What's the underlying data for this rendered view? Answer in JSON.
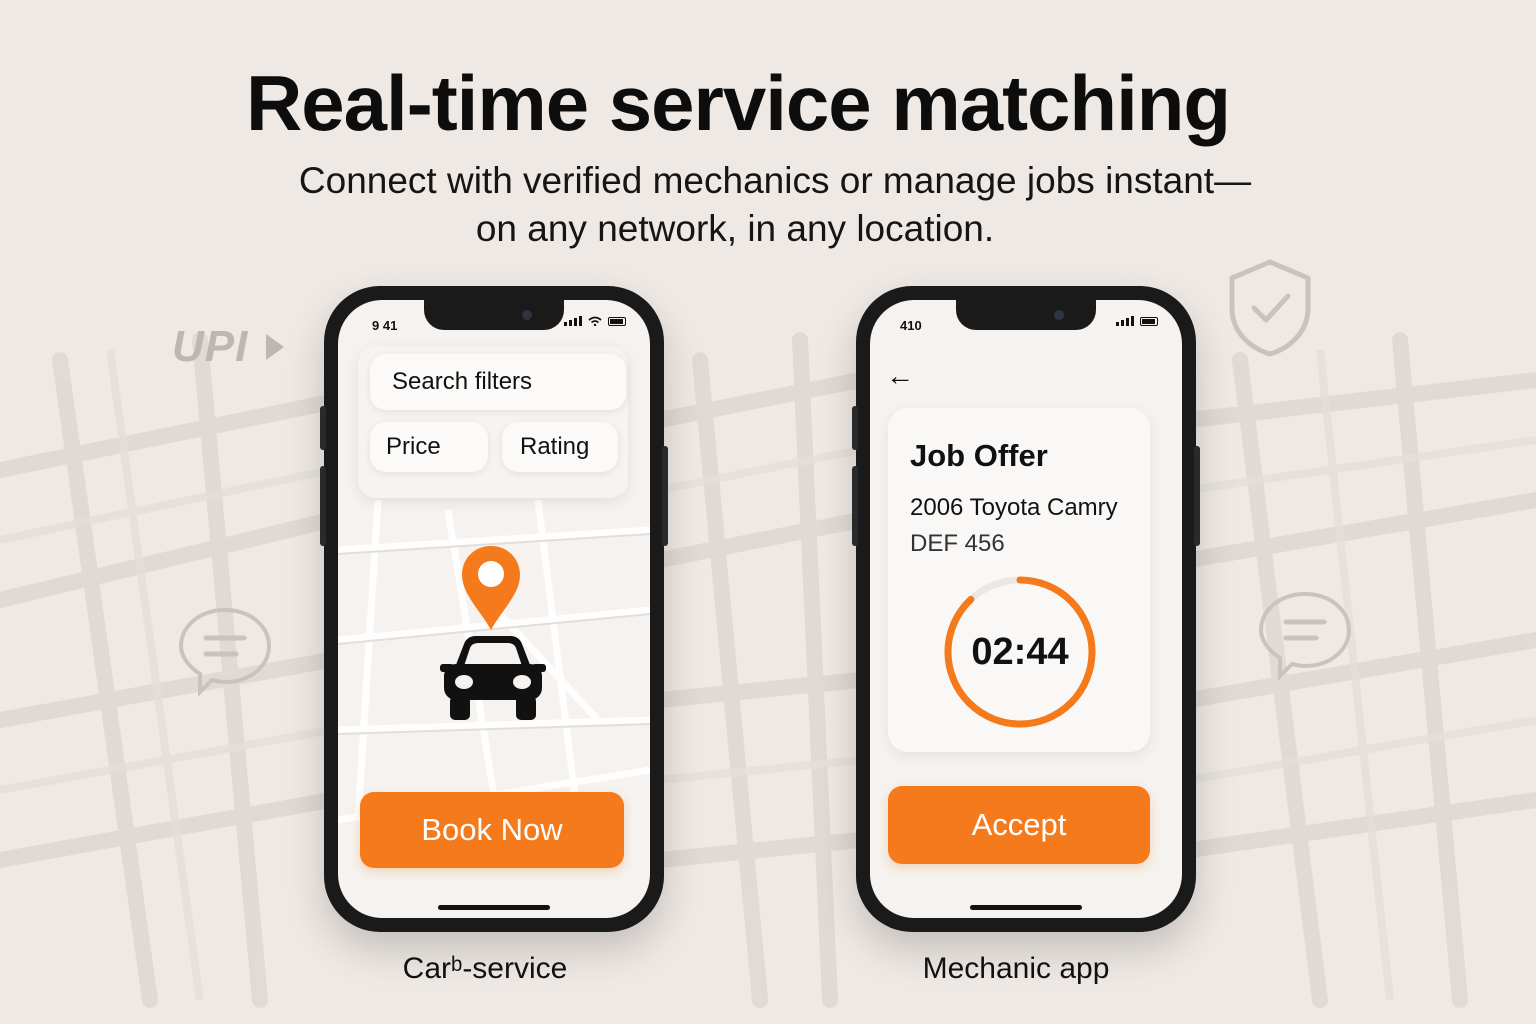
{
  "headline": "Real-time service matching",
  "subheadline_line1": "Connect with verified mechanics or manage jobs instant—",
  "subheadline_line2": "on any network, in any location.",
  "decor": {
    "upi_logo_text": "UPI",
    "shield_icon": "shield-check-icon",
    "chat_icon": "chat-bubble-icon"
  },
  "colors": {
    "accent": "#f57a1c",
    "background": "#efe9e5",
    "phone_frame": "#1a1a1a"
  },
  "customer_phone": {
    "status_time": "9 41",
    "search_label": "Search filters",
    "filters": [
      "Price",
      "Rating"
    ],
    "map_pin_icon": "map-pin-icon",
    "car_icon": "car-icon",
    "primary_button": "Book Now",
    "caption": "Carᵇ-service"
  },
  "mechanic_phone": {
    "status_time": "410",
    "back_icon": "back-arrow-icon",
    "job_title": "Job Offer",
    "vehicle": "2006 Toyota Camry",
    "plate": "DEF 456",
    "timer": "02:44",
    "timer_remaining_fraction": 0.88,
    "primary_button": "Accept",
    "caption": "Mechanic app"
  }
}
